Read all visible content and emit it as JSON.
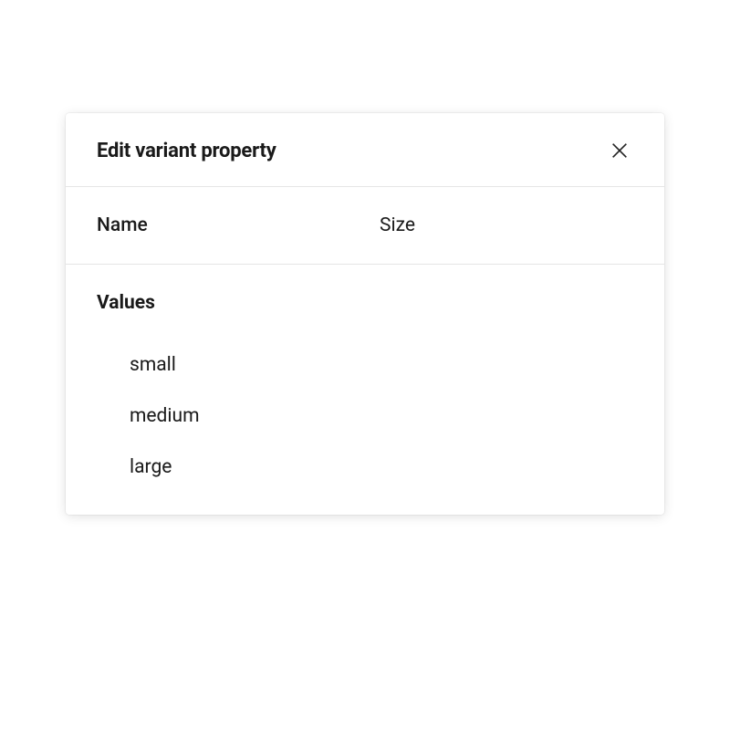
{
  "modal": {
    "title": "Edit variant property",
    "name_label": "Name",
    "name_value": "Size",
    "values_heading": "Values",
    "values": [
      "small",
      "medium",
      "large"
    ]
  }
}
